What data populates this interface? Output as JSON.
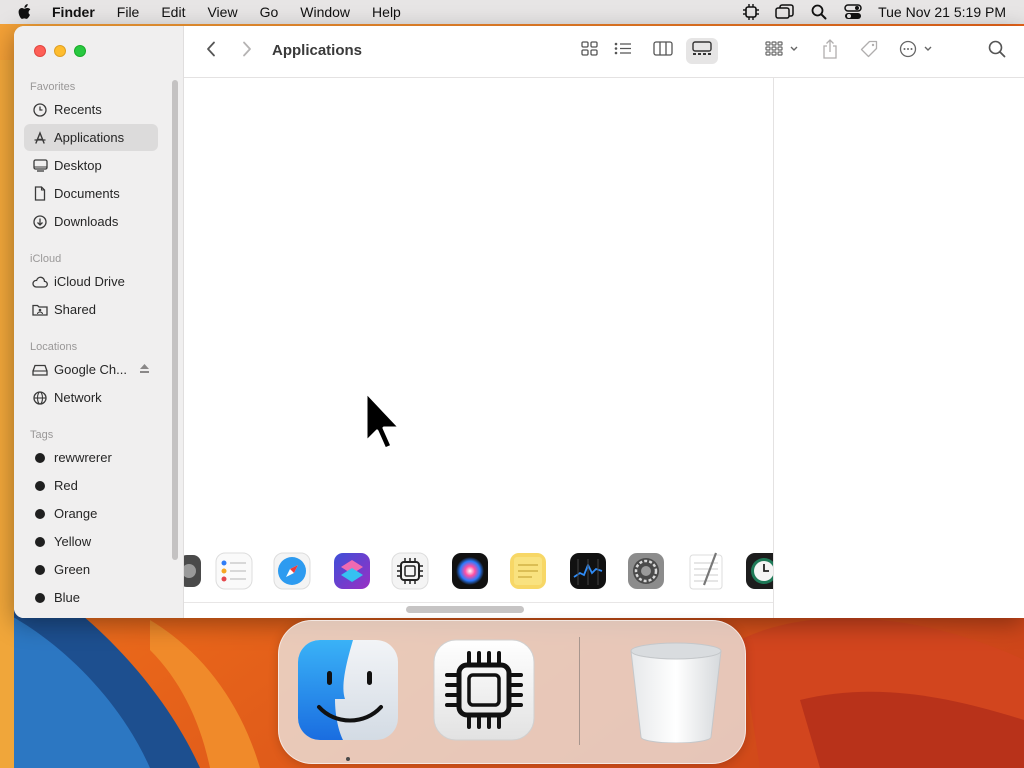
{
  "menubar": {
    "apple_icon": "apple-logo-icon",
    "app_name": "Finder",
    "menus": [
      "File",
      "Edit",
      "View",
      "Go",
      "Window",
      "Help"
    ],
    "status_icons": [
      "cpu-icon",
      "screen-mirroring-icon",
      "search-icon",
      "control-center-icon"
    ],
    "clock": "Tue Nov 21  5:19 PM"
  },
  "finder": {
    "title": "Applications",
    "sidebar": {
      "favorites_title": "Favorites",
      "favorites": [
        {
          "label": "Recents",
          "icon": "clock-icon"
        },
        {
          "label": "Applications",
          "icon": "applications-icon",
          "selected": true
        },
        {
          "label": "Desktop",
          "icon": "desktop-icon"
        },
        {
          "label": "Documents",
          "icon": "document-icon"
        },
        {
          "label": "Downloads",
          "icon": "download-icon"
        }
      ],
      "icloud_title": "iCloud",
      "icloud": [
        {
          "label": "iCloud Drive",
          "icon": "cloud-icon"
        },
        {
          "label": "Shared",
          "icon": "shared-folder-icon"
        }
      ],
      "locations_title": "Locations",
      "locations": [
        {
          "label": "Google Ch...",
          "icon": "drive-icon",
          "eject": "eject-icon"
        },
        {
          "label": "Network",
          "icon": "globe-icon"
        }
      ],
      "tags_title": "Tags",
      "tags": [
        {
          "label": "rewwrerer",
          "color": "#1f1f1f"
        },
        {
          "label": "Red",
          "color": "#1f1f1f"
        },
        {
          "label": "Orange",
          "color": "#1f1f1f"
        },
        {
          "label": "Yellow",
          "color": "#1f1f1f"
        },
        {
          "label": "Green",
          "color": "#1f1f1f"
        },
        {
          "label": "Blue",
          "color": "#1f1f1f"
        }
      ]
    },
    "toolbar": {
      "back_icon": "chevron-left-icon",
      "forward_icon": "chevron-right-icon",
      "view_icons": [
        "icon-view-icon",
        "list-view-icon",
        "column-view-icon",
        "gallery-view-icon"
      ],
      "active_view": "gallery-view-icon",
      "group_icon": "group-by-icon",
      "share_icon": "share-icon",
      "tag_icon": "tag-icon",
      "action_icon": "more-actions-icon",
      "search_icon": "search-icon"
    },
    "gallery_apps": [
      "preview-app-icon",
      "reminders-app-icon",
      "safari-app-icon",
      "shortcuts-app-icon",
      "system-information-app-icon",
      "siri-app-icon",
      "stickies-app-icon",
      "stocks-app-icon",
      "system-settings-app-icon",
      "textedit-app-icon",
      "time-machine-app-icon"
    ]
  },
  "dock": {
    "items": [
      "finder-app-icon",
      "system-information-app-icon",
      "trash-icon"
    ]
  }
}
